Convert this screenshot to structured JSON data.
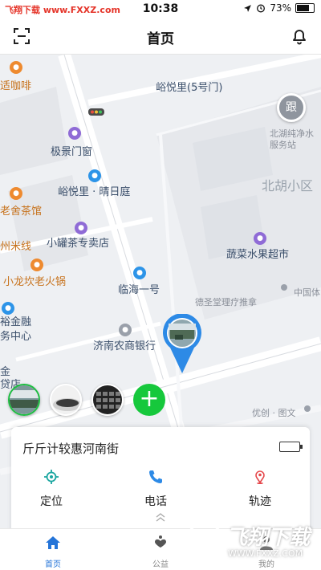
{
  "status_bar": {
    "watermark": "飞翔下载 www.FXXZ.com",
    "time": "10:38",
    "battery_percent": "73%",
    "battery_level": 0.73,
    "location_icon": "location-arrow-icon",
    "alarm_icon": "alarm-clock-icon"
  },
  "nav": {
    "title": "首页",
    "left_icon": "scan-icon",
    "right_icon": "bell-icon"
  },
  "map": {
    "follow_button": "跟",
    "pois": [
      {
        "label": "适咖啡",
        "style": "orange"
      },
      {
        "label": "峪悦里(5号门)",
        "style": "dark"
      },
      {
        "label": "北湖纯净水服务站",
        "style": "gray"
      },
      {
        "label": "极景门窗",
        "style": "dark"
      },
      {
        "label": "北胡小区",
        "style": "big"
      },
      {
        "label": "峪悦里 · 晴日庭",
        "style": "dark"
      },
      {
        "label": "老舍茶馆",
        "style": "orange"
      },
      {
        "label": "小罐茶专卖店",
        "style": "dark"
      },
      {
        "label": "州米线",
        "style": "orange"
      },
      {
        "label": "蔬菜水果超市",
        "style": "dark"
      },
      {
        "label": "小龙坎老火锅",
        "style": "orange"
      },
      {
        "label": "临海一号",
        "style": "dark"
      },
      {
        "label": "德圣堂理疗推拿",
        "style": "gray"
      },
      {
        "label": "中国体",
        "style": "gray"
      },
      {
        "label": "裕金融",
        "style": "dark"
      },
      {
        "label": "务中心",
        "style": "dark"
      },
      {
        "label": "济南农商银行",
        "style": "dark"
      },
      {
        "label": "金",
        "style": "dark"
      },
      {
        "label": "贷店",
        "style": "dark"
      },
      {
        "label": "优创 · 图文",
        "style": "gray"
      }
    ]
  },
  "card": {
    "address": "斤斤计较惠河南街",
    "actions": [
      {
        "label": "定位",
        "icon": "locate-icon"
      },
      {
        "label": "电话",
        "icon": "phone-icon"
      },
      {
        "label": "轨迹",
        "icon": "track-pin-icon"
      }
    ]
  },
  "tabs": [
    {
      "label": "首页",
      "icon": "home-icon",
      "active": true
    },
    {
      "label": "公益",
      "icon": "charity-heart-icon",
      "active": false
    },
    {
      "label": "我的",
      "icon": "user-icon",
      "active": false
    }
  ],
  "overlay_watermark": {
    "text": "飞翔下载",
    "url": "WWW.FXXZ.COM"
  },
  "colors": {
    "accent_blue": "#2474d8",
    "add_green": "#16c83c",
    "map_bg": "#eef0f3"
  }
}
